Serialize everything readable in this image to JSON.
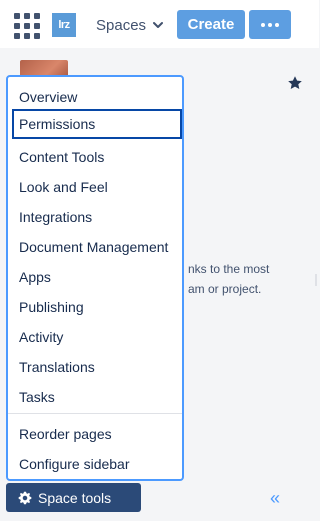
{
  "header": {
    "logo_text": "lrz",
    "spaces_label": "Spaces",
    "create_label": "Create",
    "more_icon": "more-horizontal-icon",
    "app_switcher_icon": "app-grid-icon"
  },
  "page_background": {
    "description_line1": "nks to the most",
    "description_line2": "am or project.",
    "star_icon": "star-icon"
  },
  "space_tools_menu": {
    "items": [
      {
        "label": "Overview"
      },
      {
        "label": "Permissions",
        "focused": true
      },
      {
        "label": "Content Tools"
      },
      {
        "label": "Look and Feel"
      },
      {
        "label": "Integrations"
      },
      {
        "label": "Document Management"
      },
      {
        "label": "Apps"
      },
      {
        "label": "Publishing"
      },
      {
        "label": "Activity"
      },
      {
        "label": "Translations"
      },
      {
        "label": "Tasks"
      }
    ],
    "secondary_items": [
      {
        "label": "Reorder pages"
      },
      {
        "label": "Configure sidebar"
      }
    ]
  },
  "footer": {
    "space_tools_label": "Space tools",
    "space_tools_icon": "gear-icon",
    "collapse_label": "«"
  },
  "colors": {
    "primary_button": "#5d9ee1",
    "focus_border": "#4c9aff",
    "focused_item_border": "#0747a6",
    "space_tools_bg": "#2b4a78",
    "text": "#172b4d"
  }
}
